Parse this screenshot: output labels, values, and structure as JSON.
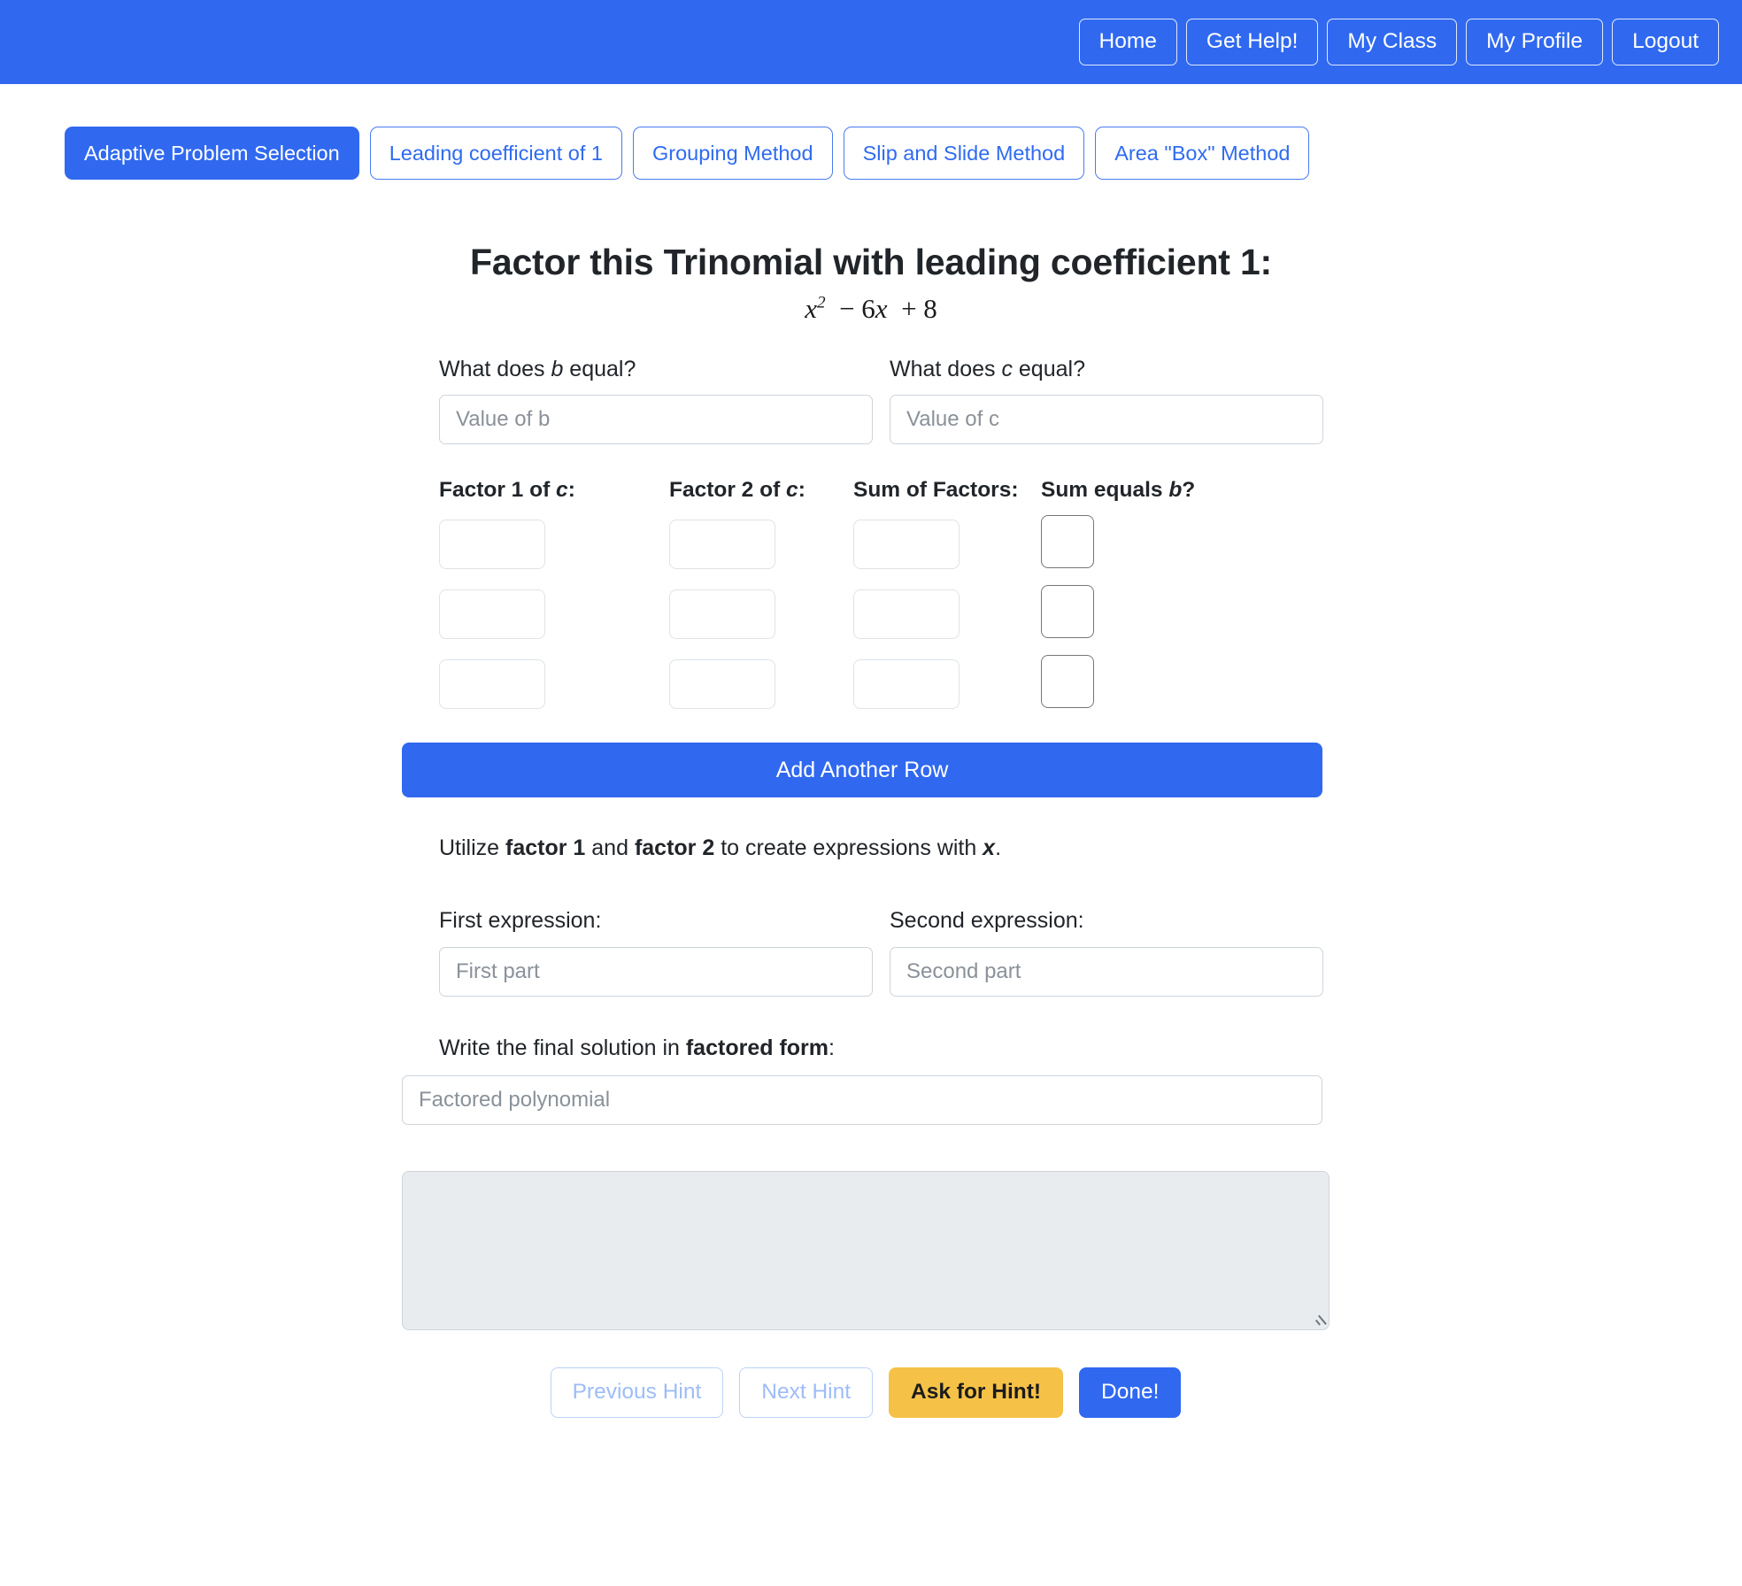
{
  "navbar": {
    "background_color": "#3069f0",
    "buttons": [
      {
        "label": "Home"
      },
      {
        "label": "Get Help!"
      },
      {
        "label": "My Class"
      },
      {
        "label": "My Profile"
      },
      {
        "label": "Logout"
      }
    ]
  },
  "tabs": [
    {
      "label": "Adaptive Problem Selection",
      "active": true
    },
    {
      "label": "Leading coefficient of 1",
      "active": false
    },
    {
      "label": "Grouping Method",
      "active": false
    },
    {
      "label": "Slip and Slide Method",
      "active": false
    },
    {
      "label": "Area \"Box\" Method",
      "active": false
    }
  ],
  "problem": {
    "title": "Factor this Trinomial with leading coefficient 1:",
    "expression_plain": "x^2 - 6x + 8",
    "expression_parts": {
      "base": "x",
      "exponent": "2",
      "linear_term": "− 6x",
      "constant_term": "+ 8"
    }
  },
  "coefficients": {
    "b_label_pre": "What does ",
    "b_label_var": "b",
    "b_label_post": " equal?",
    "b_placeholder": "Value of b",
    "b_value": "",
    "c_label_pre": "What does ",
    "c_label_var": "c",
    "c_label_post": " equal?",
    "c_placeholder": "Value of c",
    "c_value": ""
  },
  "factor_table": {
    "headers": [
      {
        "pre": "Factor 1 of ",
        "var": "c",
        "post": ":"
      },
      {
        "pre": "Factor 2 of ",
        "var": "c",
        "post": ":"
      },
      {
        "pre": "Sum of Factors:",
        "var": "",
        "post": ""
      },
      {
        "pre": "Sum equals ",
        "var": "b",
        "post": "?"
      }
    ],
    "rows": [
      {
        "factor1": "",
        "factor2": "",
        "sum": "",
        "equals_b_checked": false
      },
      {
        "factor1": "",
        "factor2": "",
        "sum": "",
        "equals_b_checked": false
      },
      {
        "factor1": "",
        "factor2": "",
        "sum": "",
        "equals_b_checked": false
      }
    ],
    "add_row_label": "Add Another Row"
  },
  "expressions": {
    "instruction_pre": "Utilize ",
    "instruction_b1": "factor 1",
    "instruction_mid": " and ",
    "instruction_b2": "factor 2",
    "instruction_post": " to create expressions with ",
    "instruction_var": "x",
    "instruction_end": ".",
    "first_label": "First expression:",
    "first_placeholder": "First part",
    "first_value": "",
    "second_label": "Second expression:",
    "second_placeholder": "Second part",
    "second_value": ""
  },
  "final_answer": {
    "label_pre": "Write the final solution in ",
    "label_bold": "factored form",
    "label_post": ":",
    "placeholder": "Factored polynomial",
    "value": ""
  },
  "hint_area": {
    "text": "",
    "placeholder": ""
  },
  "actions": {
    "previous_hint": "Previous Hint",
    "next_hint": "Next Hint",
    "ask_for_hint": "Ask for Hint!",
    "done": "Done!",
    "ask_color": "#f5c247",
    "done_color": "#3069f0",
    "disabled_text_color": "#9dbcf8"
  }
}
